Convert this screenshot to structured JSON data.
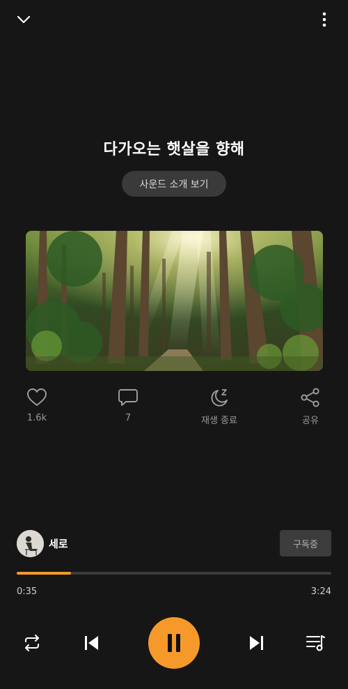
{
  "header": {
    "collapse_icon": "chevron-down-icon",
    "more_icon": "more-vertical-icon"
  },
  "track": {
    "title": "다가오는 햇살을 향해",
    "intro_label": "사운드 소개 보기",
    "artwork": "forest-sunlight-image"
  },
  "actions": {
    "like": {
      "icon": "heart-icon",
      "label": "1.6k"
    },
    "comment": {
      "icon": "comment-icon",
      "label": "7"
    },
    "sleep": {
      "icon": "moon-zzz-icon",
      "label": "재생 종료"
    },
    "share": {
      "icon": "share-icon",
      "label": "공유"
    }
  },
  "channel": {
    "name": "세로",
    "subscribe_label": "구독중"
  },
  "progress": {
    "elapsed": "0:35",
    "total": "3:24",
    "fraction": 0.1716,
    "color": "#f59a2a"
  },
  "controls": {
    "repeat_icon": "repeat-icon",
    "prev_icon": "skip-previous-icon",
    "pause_icon": "pause-icon",
    "next_icon": "skip-next-icon",
    "playlist_icon": "playlist-icon"
  },
  "colors": {
    "background": "#161616",
    "accent": "#f59a2a"
  }
}
